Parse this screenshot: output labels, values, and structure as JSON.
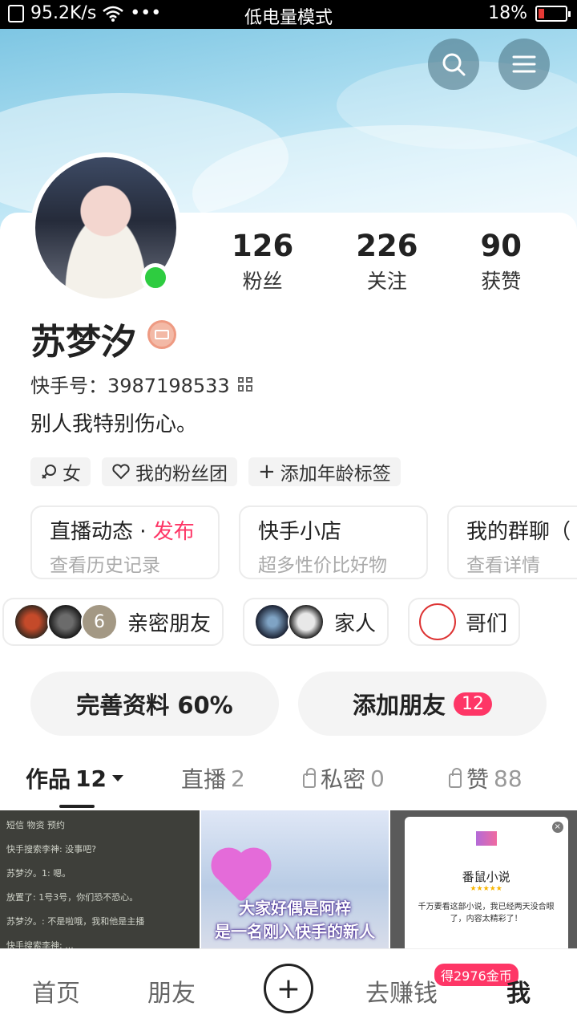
{
  "status_bar": {
    "speed": "95.2K/s",
    "more": "•••",
    "mode": "低电量模式",
    "battery": "18%",
    "battery_level": 0.18
  },
  "header": {
    "search_icon": "search-icon",
    "menu_icon": "menu-icon"
  },
  "profile": {
    "stats": [
      {
        "num": "126",
        "label": "粉丝"
      },
      {
        "num": "226",
        "label": "关注"
      },
      {
        "num": "90",
        "label": "获赞"
      }
    ],
    "name": "苏梦汐",
    "kuaishou_id": "快手号：3987198533",
    "bio": "别人我特别伤心。",
    "tags": [
      {
        "icon": "female-icon",
        "label": "女"
      },
      {
        "icon": "heart-icon",
        "label": "我的粉丝团"
      },
      {
        "icon": "plus-icon",
        "label": "添加年龄标签"
      }
    ],
    "cards": [
      {
        "title": "直播动态 · ",
        "highlight": "发布",
        "sub": "查看历史记录"
      },
      {
        "title": "快手小店",
        "highlight": "",
        "sub": "超多性价比好物"
      },
      {
        "title": "我的群聊（",
        "highlight": "",
        "sub": "查看详情"
      }
    ],
    "groups": [
      {
        "label": "亲密朋友",
        "avatars": [
          "",
          "",
          "6"
        ]
      },
      {
        "label": "家人",
        "avatars": [
          "",
          ""
        ]
      },
      {
        "label": "哥们",
        "avatars": [
          ""
        ]
      }
    ],
    "actions": {
      "complete": "完善资料 60%",
      "add_friend": "添加朋友",
      "add_friend_count": "12"
    }
  },
  "content_tabs": [
    {
      "label": "作品",
      "count": "12"
    },
    {
      "label": "直播",
      "count": "2"
    },
    {
      "label": "私密",
      "count": "0"
    },
    {
      "label": "赞",
      "count": "88"
    }
  ],
  "grid": {
    "cell1": {
      "lines": [
        "短信    物资    预约",
        "快手搜索李神: 没事吧?",
        "苏梦汐。1: 嗯。",
        "放置了: 1号3号，你们恐不恐心。",
        "苏梦汐。: 不是啦哦，我和他是主播",
        "快手搜索李神: ..."
      ]
    },
    "cell2": {
      "caption1": "大家好偶是阿梓",
      "caption2": "是一名刚入快手的新人"
    },
    "cell3": {
      "title": "番鼠小说",
      "stars": "★★★★★",
      "desc": "千万要看这部小说，我已经两天没合眼了，内容太精彩了！",
      "close": "×"
    }
  },
  "bottom_nav": {
    "home": "首页",
    "friends": "朋友",
    "plus": "+",
    "earn": "去赚钱",
    "coins": "得2976金币",
    "me": "我"
  }
}
